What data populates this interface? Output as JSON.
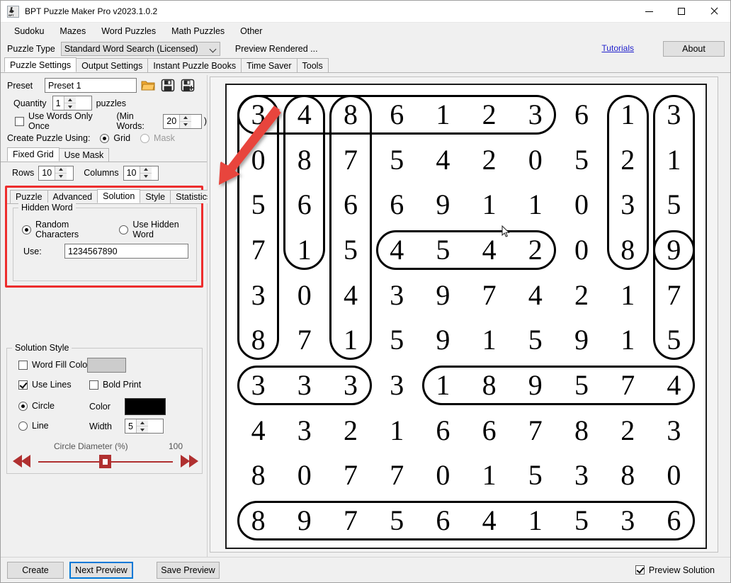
{
  "window": {
    "title": "BPT Puzzle Maker Pro v2023.1.0.2",
    "app_icon": "bpt-app-icon",
    "minimize": "minimize-icon",
    "maximize": "maximize-icon",
    "close": "close-icon"
  },
  "menubar": {
    "items": [
      {
        "label": "Sudoku"
      },
      {
        "label": "Mazes"
      },
      {
        "label": "Word Puzzles"
      },
      {
        "label": "Math Puzzles"
      },
      {
        "label": "Other"
      }
    ]
  },
  "typerow": {
    "label": "Puzzle Type",
    "combo_value": "Standard Word Search (Licensed)",
    "status": "Preview Rendered ...",
    "tutorials_link": "Tutorials",
    "about_button": "About"
  },
  "main_tabs": {
    "items": [
      {
        "label": "Puzzle Settings",
        "active": true
      },
      {
        "label": "Output Settings",
        "active": false
      },
      {
        "label": "Instant Puzzle Books",
        "active": false
      },
      {
        "label": "Time Saver",
        "active": false
      },
      {
        "label": "Tools",
        "active": false
      }
    ]
  },
  "preset": {
    "label": "Preset",
    "value": "Preset 1",
    "placeholder": "Preset name",
    "open_icon": "folder-open-icon",
    "save_icon": "save-icon",
    "save_as_icon": "save-as-icon"
  },
  "quantity": {
    "label": "Quantity",
    "value": "1",
    "suffix": "puzzles"
  },
  "use_words_only_once": {
    "label": "Use Words Only Once",
    "checked": false,
    "min_words_label": "(Min Words:",
    "min_words_value": "20",
    "min_words_suffix": ")"
  },
  "create_using": {
    "label": "Create Puzzle Using:",
    "grid_label": "Grid",
    "grid_selected": true,
    "mask_label": "Mask",
    "mask_selected": false,
    "mask_disabled": true
  },
  "grid_tabs": {
    "items": [
      {
        "label": "Fixed Grid",
        "active": true
      },
      {
        "label": "Use Mask",
        "active": false
      }
    ]
  },
  "dimensions": {
    "rows_label": "Rows",
    "rows_value": "10",
    "columns_label": "Columns",
    "columns_value": "10"
  },
  "highlight": {
    "color": "#ed2d2d",
    "arrow_color": "#e8443c"
  },
  "settings_tabs": {
    "items": [
      {
        "label": "Puzzle",
        "active": false
      },
      {
        "label": "Advanced",
        "active": false
      },
      {
        "label": "Solution",
        "active": true
      },
      {
        "label": "Style",
        "active": false
      },
      {
        "label": "Statistics",
        "active": false
      }
    ]
  },
  "hidden_word": {
    "group_title": "Hidden Word",
    "random_label": "Random Characters",
    "random_selected": true,
    "use_hidden_label": "Use Hidden Word",
    "use_hidden_selected": false,
    "use_label": "Use:",
    "use_value": "1234567890",
    "use_placeholder": "Characters"
  },
  "solution_style": {
    "group_title": "Solution Style",
    "word_fill_color_label": "Word Fill Color",
    "word_fill_color_checked": false,
    "word_fill_swatch": "#cccccc",
    "use_lines_label": "Use Lines",
    "use_lines_checked": true,
    "bold_print_label": "Bold Print",
    "bold_print_checked": false,
    "circle_label": "Circle",
    "circle_selected": true,
    "line_label": "Line",
    "line_selected": false,
    "color_label": "Color",
    "color_swatch": "#000000",
    "width_label": "Width",
    "width_value": "5",
    "slider_label": "Circle Diameter (%)",
    "slider_value": "100",
    "slider_first_icon": "double-left-arrow-icon",
    "slider_prev_icon": "left-arrow-icon",
    "slider_next_icon": "right-arrow-icon",
    "slider_last_icon": "double-right-arrow-icon"
  },
  "bottom": {
    "create_button": "Create",
    "next_preview_button": "Next Preview",
    "save_preview_button": "Save Preview",
    "preview_solution_label": "Preview Solution",
    "preview_solution_checked": true
  },
  "puzzle": {
    "rows": 10,
    "columns": 10,
    "cells": [
      [
        "3",
        "4",
        "8",
        "6",
        "1",
        "2",
        "3",
        "6",
        "1",
        "3"
      ],
      [
        "0",
        "8",
        "7",
        "5",
        "4",
        "2",
        "0",
        "5",
        "2",
        "1"
      ],
      [
        "5",
        "6",
        "6",
        "6",
        "9",
        "1",
        "1",
        "0",
        "3",
        "5"
      ],
      [
        "7",
        "1",
        "5",
        "4",
        "5",
        "4",
        "2",
        "0",
        "8",
        "9"
      ],
      [
        "3",
        "0",
        "4",
        "3",
        "9",
        "7",
        "4",
        "2",
        "1",
        "7"
      ],
      [
        "8",
        "7",
        "1",
        "5",
        "9",
        "1",
        "5",
        "9",
        "1",
        "5"
      ],
      [
        "3",
        "3",
        "3",
        "3",
        "1",
        "8",
        "9",
        "5",
        "7",
        "4"
      ],
      [
        "4",
        "3",
        "2",
        "1",
        "6",
        "6",
        "7",
        "8",
        "2",
        "3"
      ],
      [
        "8",
        "0",
        "7",
        "7",
        "0",
        "1",
        "5",
        "3",
        "8",
        "0"
      ],
      [
        "8",
        "9",
        "7",
        "5",
        "6",
        "4",
        "1",
        "5",
        "3",
        "6"
      ]
    ],
    "solution_marks": [
      {
        "name": "row1-cols1-7",
        "orientation": "horizontal",
        "row": 1,
        "col_start": 1,
        "col_end": 7
      },
      {
        "name": "row4-cols4-7",
        "orientation": "horizontal",
        "row": 4,
        "col_start": 4,
        "col_end": 7
      },
      {
        "name": "row7-cols1-3",
        "orientation": "horizontal",
        "row": 7,
        "col_start": 1,
        "col_end": 3
      },
      {
        "name": "row7-cols5-10",
        "orientation": "horizontal",
        "row": 7,
        "col_start": 5,
        "col_end": 10
      },
      {
        "name": "row10-cols1-10",
        "orientation": "horizontal",
        "row": 10,
        "col_start": 1,
        "col_end": 10
      },
      {
        "name": "col1-rows1-6",
        "orientation": "vertical",
        "col": 1,
        "row_start": 1,
        "row_end": 6
      },
      {
        "name": "col2-rows1-4",
        "orientation": "vertical",
        "col": 2,
        "row_start": 1,
        "row_end": 4
      },
      {
        "name": "col3-rows1-6",
        "orientation": "vertical",
        "col": 3,
        "row_start": 1,
        "row_end": 6
      },
      {
        "name": "col9-rows1-4",
        "orientation": "vertical",
        "col": 9,
        "row_start": 1,
        "row_end": 4
      },
      {
        "name": "col10-rows1-6",
        "orientation": "vertical",
        "col": 10,
        "row_start": 1,
        "row_end": 6
      },
      {
        "name": "single-r4c10",
        "orientation": "single",
        "row": 4,
        "col": 10
      }
    ]
  }
}
